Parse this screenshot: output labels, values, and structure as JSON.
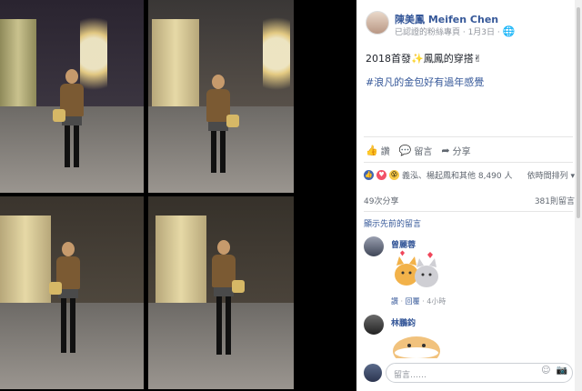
{
  "post": {
    "page_name": "陳美鳳 Meifen Chen",
    "meta": "已認證的粉絲專頁 · 1月3日 · ",
    "text": "2018首發✨鳳鳳的穿搭✌",
    "hashtag": "#浪凡的金包好有過年感覺"
  },
  "actions": {
    "like": "讚",
    "comment": "留言",
    "share": "分享"
  },
  "reactions": {
    "summary": "義泓、楊起鳳和其他 8,490 人",
    "sort": "依時間排列 ▾"
  },
  "stats": {
    "shares": "49次分享",
    "comments": "381則留言"
  },
  "prev_comments": "顯示先前的留言",
  "comments": [
    {
      "name": "曾麗蓉",
      "links": {
        "like": "讚",
        "sep": " · ",
        "reply": "回覆",
        "time": " · 4小時"
      }
    },
    {
      "name": "林鵬鈞"
    }
  ],
  "composer": {
    "placeholder": "留言……"
  },
  "icons": [
    "like-icon",
    "comment-icon",
    "share-icon",
    "emoji-icon",
    "camera-icon"
  ],
  "colors": {
    "link": "#365899",
    "muted": "#90949c"
  }
}
